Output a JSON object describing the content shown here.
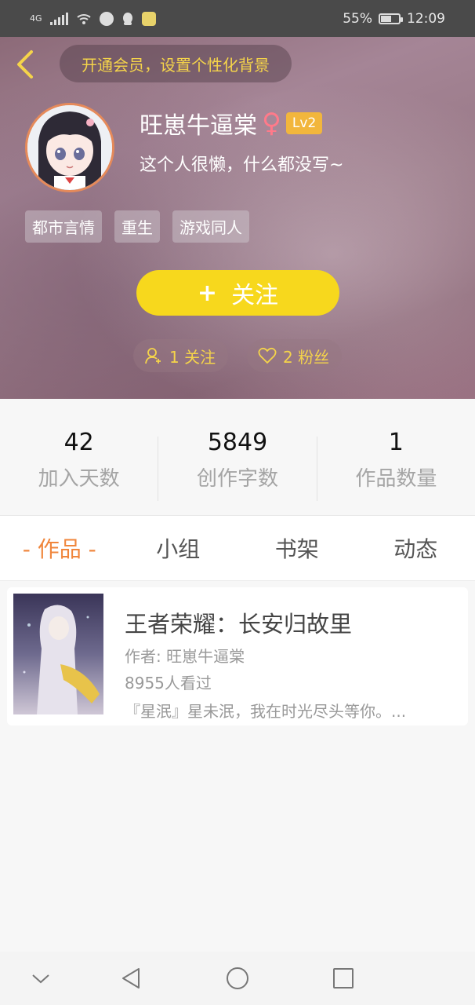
{
  "status_bar": {
    "network": "4G",
    "battery": "55%",
    "time": "12:09"
  },
  "header": {
    "vip_banner": "开通会员，设置个性化背景",
    "username": "旺崽牛逼棠",
    "gender_symbol": "♀",
    "level": "Lv2",
    "bio": "这个人很懒，什么都没写~",
    "tags": [
      "都市言情",
      "重生",
      "游戏同人"
    ],
    "follow_button": {
      "plus": "+",
      "label": "关注"
    },
    "following": "1 关注",
    "fans": "2 粉丝"
  },
  "stats": [
    {
      "value": "42",
      "label": "加入天数"
    },
    {
      "value": "5849",
      "label": "创作字数"
    },
    {
      "value": "1",
      "label": "作品数量"
    }
  ],
  "tabs": [
    "- 作品 -",
    "小组",
    "书架",
    "动态"
  ],
  "book": {
    "title": "王者荣耀：长安归故里",
    "author": "作者: 旺崽牛逼棠",
    "views": "8955人看过",
    "description": "『星泯』星未泯，我在时光尽头等你。..."
  },
  "colors": {
    "accent_yellow": "#f7d81d",
    "tab_active": "#f0863c",
    "level_badge": "#f2b63c"
  },
  "icons": [
    "back-chevron-icon",
    "person-icon",
    "heart-icon",
    "nav-down-icon",
    "nav-back-icon",
    "nav-home-icon",
    "nav-recent-icon"
  ]
}
